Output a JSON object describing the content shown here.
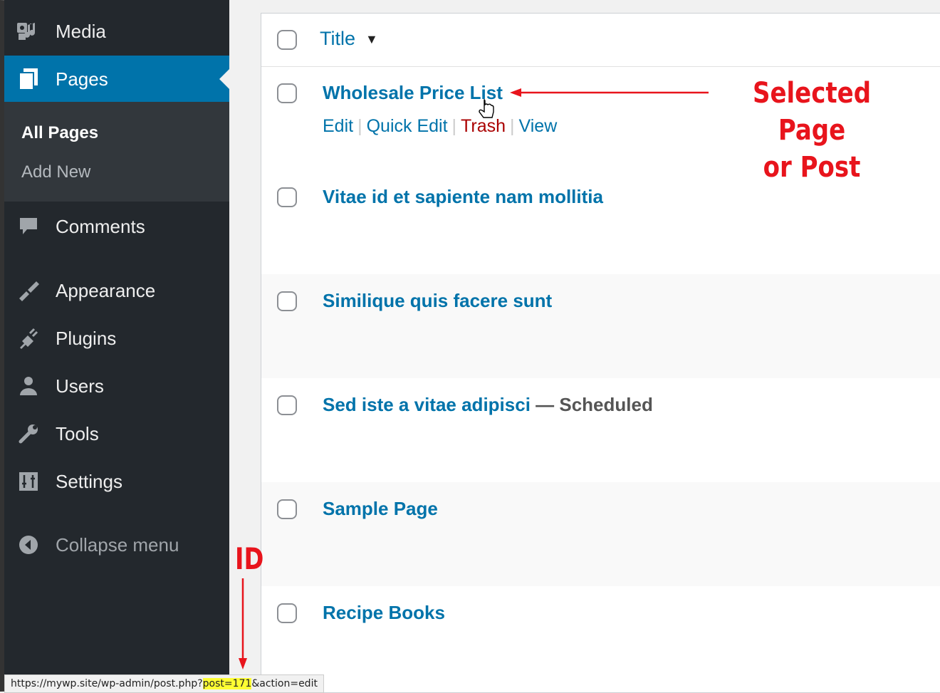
{
  "sidebar": {
    "items": [
      {
        "label": "Media",
        "icon": "media-icon"
      },
      {
        "label": "Pages",
        "icon": "pages-icon"
      },
      {
        "label": "Comments",
        "icon": "comments-icon"
      },
      {
        "label": "Appearance",
        "icon": "appearance-icon"
      },
      {
        "label": "Plugins",
        "icon": "plugins-icon"
      },
      {
        "label": "Users",
        "icon": "users-icon"
      },
      {
        "label": "Tools",
        "icon": "tools-icon"
      },
      {
        "label": "Settings",
        "icon": "settings-icon"
      },
      {
        "label": "Collapse menu",
        "icon": "collapse-icon"
      }
    ],
    "submenu": [
      {
        "label": "All Pages"
      },
      {
        "label": "Add New"
      }
    ]
  },
  "table": {
    "header": {
      "title_label": "Title",
      "sort_indicator": "▼"
    },
    "rows": [
      {
        "title": "Wholesale Price List",
        "state": "",
        "actions": {
          "edit": "Edit",
          "quick_edit": "Quick Edit",
          "trash": "Trash",
          "view": "View"
        }
      },
      {
        "title": "Vitae id et sapiente nam mollitia",
        "state": ""
      },
      {
        "title": "Similique quis facere sunt",
        "state": ""
      },
      {
        "title": "Sed iste a vitae adipisci",
        "state": " — Scheduled"
      },
      {
        "title": "Sample Page",
        "state": ""
      },
      {
        "title": "Recipe Books",
        "state": ""
      }
    ]
  },
  "annotations": {
    "selected_line1": "Selected Page",
    "selected_line2": "or Post",
    "id_label": "ID"
  },
  "statusbar": {
    "url_prefix": "https://mywp.site/wp-admin/post.php?",
    "url_highlight": "post=171",
    "url_suffix": "&action=edit"
  },
  "colors": {
    "sidebar_bg": "#23282d",
    "accent": "#0073aa",
    "annotation": "#e8141c",
    "trash": "#aa0000",
    "highlight": "#ffff33"
  }
}
